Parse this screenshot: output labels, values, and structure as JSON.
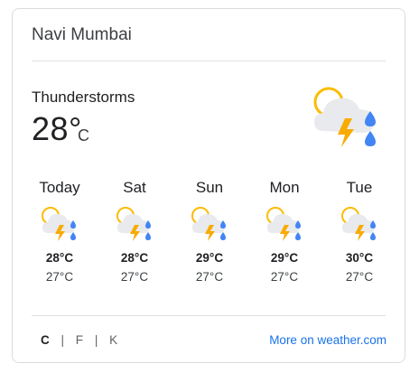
{
  "location": "Navi Mumbai",
  "current": {
    "condition": "Thunderstorms",
    "temp": "28°",
    "unit": "C",
    "icon": "thunderstorm-sun-icon"
  },
  "forecast": [
    {
      "day": "Today",
      "high": "28°C",
      "low": "27°C",
      "icon": "thunderstorm-sun-icon"
    },
    {
      "day": "Sat",
      "high": "28°C",
      "low": "27°C",
      "icon": "thunderstorm-sun-icon"
    },
    {
      "day": "Sun",
      "high": "29°C",
      "low": "27°C",
      "icon": "thunderstorm-sun-icon"
    },
    {
      "day": "Mon",
      "high": "29°C",
      "low": "27°C",
      "icon": "thunderstorm-sun-icon"
    },
    {
      "day": "Tue",
      "high": "30°C",
      "low": "27°C",
      "icon": "thunderstorm-sun-icon"
    }
  ],
  "units": {
    "c": "C",
    "f": "F",
    "k": "K",
    "separator": "|",
    "active": "C"
  },
  "more_link": "More on weather.com",
  "colors": {
    "sun": "#fbbc04",
    "cloud": "#e8eaed",
    "bolt": "#f9ab00",
    "rain": "#4285f4",
    "link": "#1a73e8"
  }
}
